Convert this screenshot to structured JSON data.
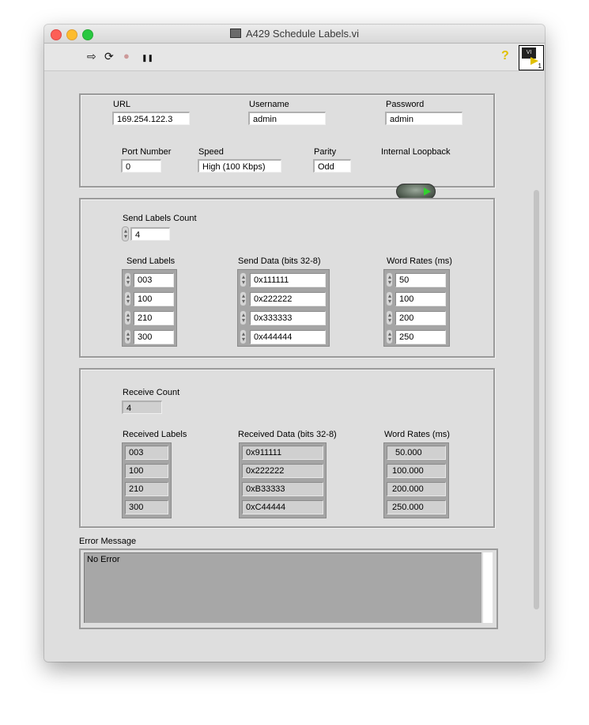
{
  "window": {
    "title": "A429 Schedule Labels.vi"
  },
  "toolbar": {
    "run": "⇨",
    "run_continuous": "⟳",
    "abort": "●",
    "pause": "❚❚",
    "help": "?",
    "vi_icon_text": "VI",
    "vi_icon_num": "1"
  },
  "connection": {
    "url": {
      "label": "URL",
      "value": "169.254.122.3"
    },
    "username": {
      "label": "Username",
      "value": "admin"
    },
    "password": {
      "label": "Password",
      "value": "admin"
    },
    "port": {
      "label": "Port Number",
      "value": "0"
    },
    "speed": {
      "label": "Speed",
      "value": "High (100 Kbps)"
    },
    "parity": {
      "label": "Parity",
      "value": "Odd"
    },
    "loopback": {
      "label": "Internal Loopback",
      "state": true
    }
  },
  "send": {
    "count_label": "Send Labels Count",
    "count_value": "4",
    "labels_header": "Send Labels",
    "data_header": "Send Data (bits 32-8)",
    "rates_header": "Word Rates (ms)",
    "labels": [
      "003",
      "100",
      "210",
      "300"
    ],
    "data": [
      "0x111111",
      "0x222222",
      "0x333333",
      "0x444444"
    ],
    "rates": [
      "50",
      "100",
      "200",
      "250"
    ]
  },
  "receive": {
    "count_label": "Receive Count",
    "count_value": "4",
    "labels_header": "Received Labels",
    "data_header": "Received Data  (bits 32-8)",
    "rates_header": "Word Rates (ms)",
    "labels": [
      "003",
      "100",
      "210",
      "300"
    ],
    "data": [
      "0x911111",
      "0x222222",
      "0xB33333",
      "0xC44444"
    ],
    "rates": [
      "50.000",
      "100.000",
      "200.000",
      "250.000"
    ]
  },
  "error": {
    "label": "Error Message",
    "value": "No Error"
  },
  "colors": {
    "panel_bg": "#dedede",
    "led_on": "#32d12e",
    "indicator_bg": "#d0d0d0"
  }
}
